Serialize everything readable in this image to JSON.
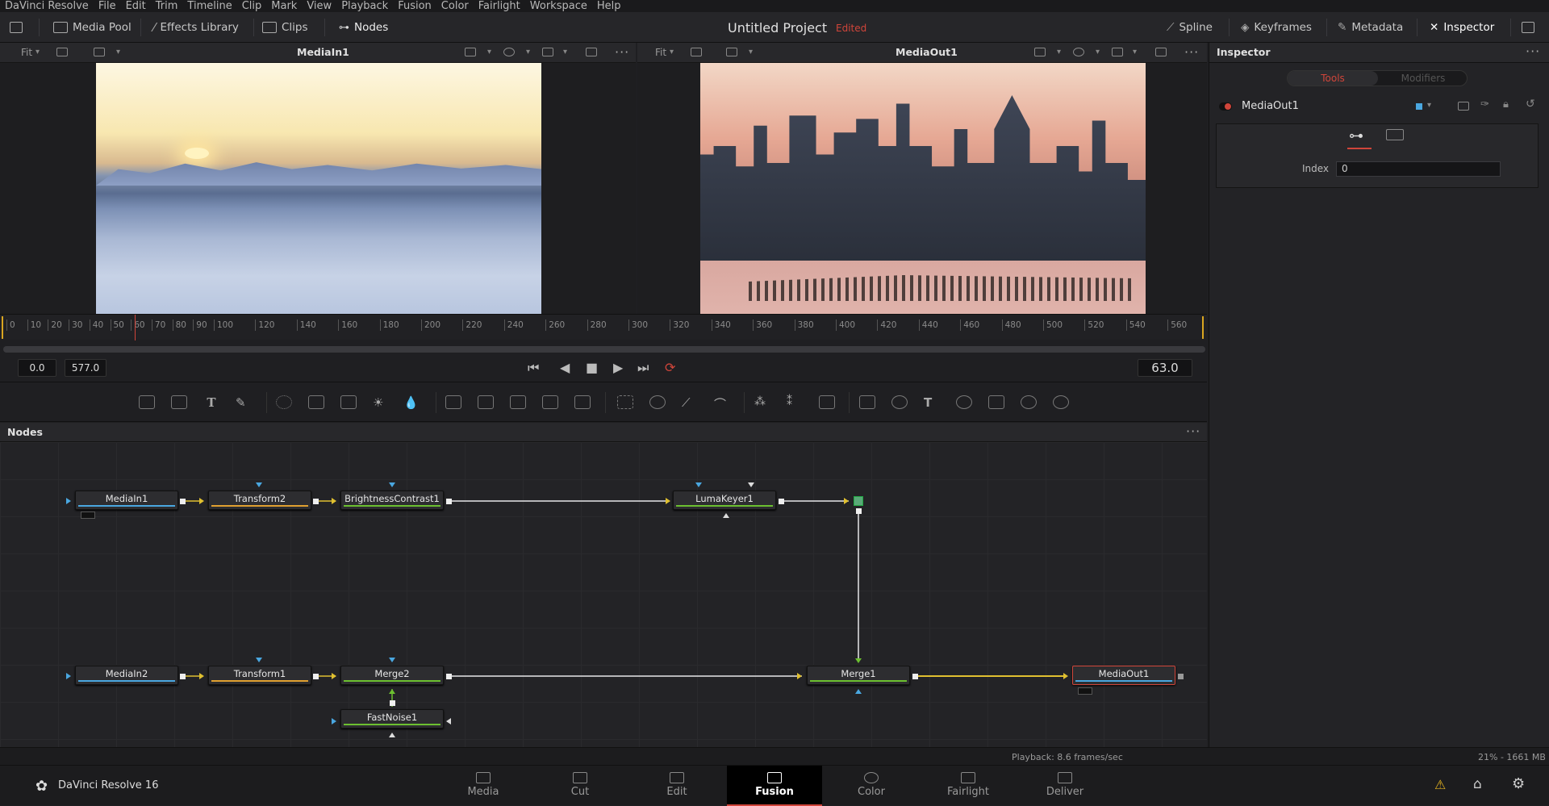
{
  "menu": [
    "DaVinci Resolve",
    "File",
    "Edit",
    "Trim",
    "Timeline",
    "Clip",
    "Mark",
    "View",
    "Playback",
    "Fusion",
    "Color",
    "Fairlight",
    "Workspace",
    "Help"
  ],
  "toolbar": {
    "media_pool": "Media Pool",
    "effects_library": "Effects Library",
    "clips": "Clips",
    "nodes": "Nodes",
    "spline": "Spline",
    "keyframes": "Keyframes",
    "metadata": "Metadata",
    "inspector": "Inspector"
  },
  "project": {
    "title": "Untitled Project",
    "status": "Edited"
  },
  "viewer_left": {
    "fit": "Fit",
    "title": "MediaIn1"
  },
  "viewer_right": {
    "fit": "Fit",
    "title": "MediaOut1"
  },
  "ruler_ticks": [
    "0",
    "10",
    "20",
    "30",
    "40",
    "50",
    "60",
    "70",
    "80",
    "90",
    "100",
    "120",
    "140",
    "160",
    "180",
    "200",
    "220",
    "240",
    "260",
    "280",
    "300",
    "320",
    "340",
    "360",
    "380",
    "400",
    "420",
    "440",
    "460",
    "480",
    "500",
    "520",
    "540",
    "560"
  ],
  "transport": {
    "start": "0.0",
    "end": "577.0",
    "current": "63.0"
  },
  "nodes_panel": {
    "title": "Nodes",
    "nodes": {
      "mediain1": "MediaIn1",
      "transform2": "Transform2",
      "brightness": "BrightnessContrast1",
      "lumakeyer": "LumaKeyer1",
      "mediain2": "MediaIn2",
      "transform1": "Transform1",
      "merge2": "Merge2",
      "fastnoise": "FastNoise1",
      "merge1": "Merge1",
      "mediaout1": "MediaOut1"
    }
  },
  "status": {
    "playback": "Playback: 8.6 frames/sec",
    "memory": "21% - 1661 MB"
  },
  "inspector": {
    "title": "Inspector",
    "tabs": [
      "Tools",
      "Modifiers"
    ],
    "node_name": "MediaOut1",
    "index_label": "Index",
    "index_value": "0"
  },
  "app_name": "DaVinci Resolve 16",
  "pages": [
    "Media",
    "Cut",
    "Edit",
    "Fusion",
    "Color",
    "Fairlight",
    "Deliver"
  ],
  "colors": {
    "accent": "#d0453a",
    "bg": "#1f1f22"
  }
}
